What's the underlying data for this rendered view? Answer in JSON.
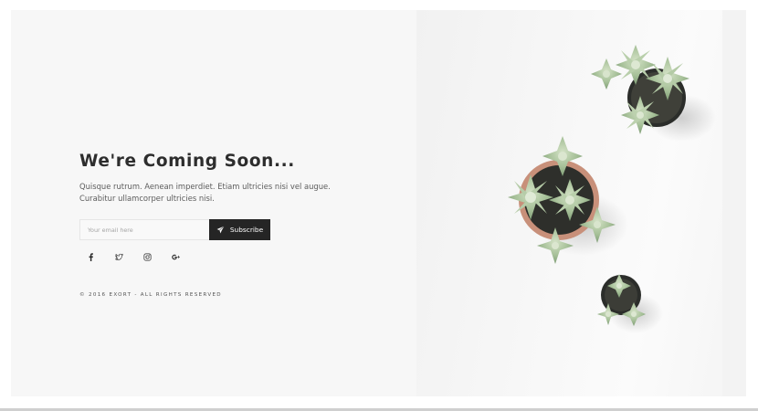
{
  "page": {
    "heading": "We're Coming Soon...",
    "description_lines": [
      "Quisque rutrum. Aenean imperdiet. Etiam ultricies nisi vel augue.",
      "Curabitur ullamcorper ultricies nisi."
    ]
  },
  "subscribe_form": {
    "email_placeholder": "Your email here",
    "email_value": "",
    "button_label": "Subscribe",
    "button_icon": "paper-plane-icon"
  },
  "social_links": [
    {
      "name": "facebook",
      "icon": "facebook-icon"
    },
    {
      "name": "twitter",
      "icon": "twitter-icon"
    },
    {
      "name": "instagram",
      "icon": "instagram-icon"
    },
    {
      "name": "google-plus",
      "icon": "google-plus-icon"
    }
  ],
  "footer": {
    "copyright": "© 2016 EXORT - ALL RIGHTS RESERVED"
  },
  "hero_image": {
    "subject": "potted succulent plants from above"
  },
  "colors": {
    "background": "#f7f7f7",
    "heading": "#2d2d2d",
    "button": "#252525",
    "plant_green": "#9fba93",
    "pot_terracotta": "#c8907a"
  }
}
